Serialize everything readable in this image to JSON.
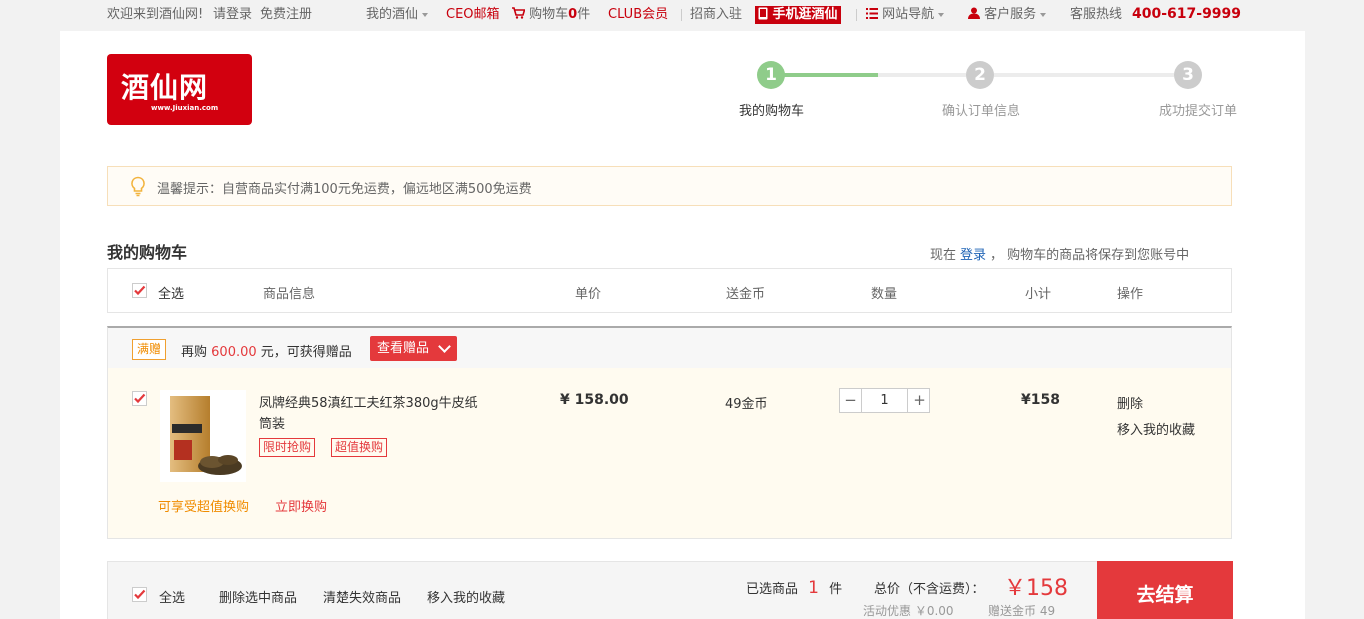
{
  "topbar": {
    "welcome": "欢迎来到酒仙网!",
    "login": "请登录",
    "register": "免费注册",
    "my_jiuxian": "我的酒仙",
    "ceo_mail": "CEO邮箱",
    "cart_label": "购物车",
    "cart_count": "0",
    "cart_unit": "件",
    "club": "CLUB会员",
    "merchant": "招商入驻",
    "mobile": "手机逛酒仙",
    "site_nav": "网站导航",
    "service": "客户服务",
    "hotline_label": "客服热线",
    "hotline": "400-617-9999"
  },
  "logo": {
    "text": "酒仙网",
    "domain": "www.Jiuxian.com"
  },
  "steps": [
    {
      "num": "1",
      "label": "我的购物车",
      "active": true
    },
    {
      "num": "2",
      "label": "确认订单信息",
      "active": false
    },
    {
      "num": "3",
      "label": "成功提交订单",
      "active": false
    }
  ],
  "tip": "温馨提示：自营商品实付满100元免运费，偏远地区满500免运费",
  "cart_title": "我的购物车",
  "login_hint": {
    "prefix": "现在",
    "link": "登录",
    "suffix": "， 购物车的商品将保存到您账号中"
  },
  "table_header": {
    "select_all": "全选",
    "product_info": "商品信息",
    "unit_price": "单价",
    "coins": "送金币",
    "quantity": "数量",
    "subtotal": "小计",
    "actions": "操作"
  },
  "promo": {
    "badge": "满赠",
    "text_prefix": "再购",
    "amount": "600.00",
    "text_suffix": "元，可获得赠品",
    "button": "查看赠品"
  },
  "item": {
    "name_line1": "凤牌经典58滇红工夫红茶380g牛皮纸",
    "name_line2": "筒装",
    "tags": [
      "限时抢购",
      "超值换购"
    ],
    "price": "¥ 158.00",
    "coins": "49金币",
    "quantity": "1",
    "subtotal": "¥158",
    "delete": "删除",
    "move_fav": "移入我的收藏",
    "exchange_hint": "可享受超值换购",
    "exchange_link": "立即换购"
  },
  "footer": {
    "select_all": "全选",
    "delete_selected": "删除选中商品",
    "clear_invalid": "清楚失效商品",
    "move_fav": "移入我的收藏",
    "selected_prefix": "已选商品",
    "selected_count": "1",
    "selected_unit": "件",
    "total_label": "总价（不含运费）：",
    "total": "￥158",
    "discount": "活动优惠 ￥0.00",
    "gift_coins": "赠送金币 49",
    "checkout": "去结算"
  },
  "colors": {
    "brand_red": "#d2000f",
    "accent_red": "#e4393c",
    "step_active": "#8fcc8a",
    "step_inactive": "#cccccc",
    "link_blue": "#1f64b6"
  }
}
